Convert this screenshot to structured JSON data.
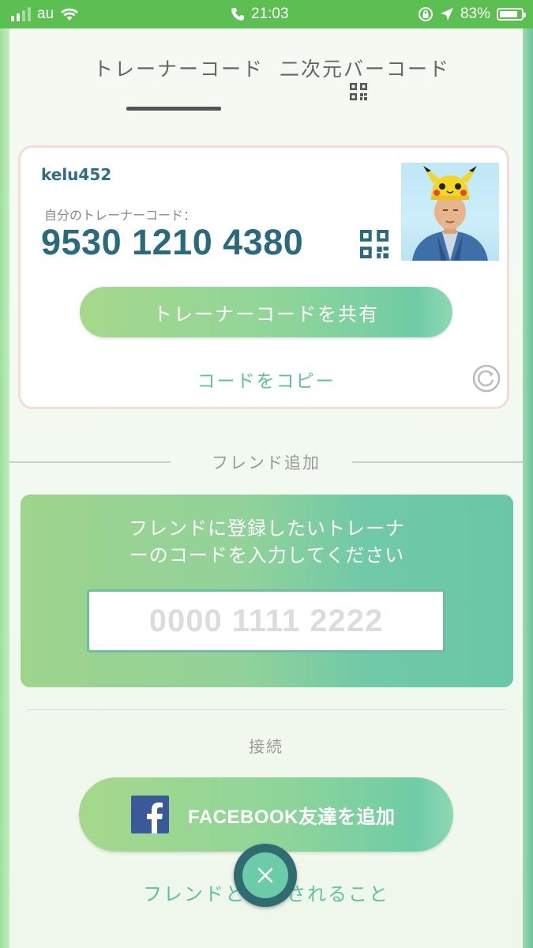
{
  "status_bar": {
    "carrier": "au",
    "time": "21:03",
    "battery": "83%",
    "battery_level": 0.83,
    "icons": [
      "signal-icon",
      "wifi-icon",
      "phone-icon",
      "orientation-lock-icon",
      "location-arrow-icon",
      "battery-icon"
    ]
  },
  "tabs": {
    "trainer_code": "トレーナーコード",
    "qr_code": "二次元バーコード",
    "active": "trainer_code"
  },
  "card": {
    "username": "kelu452",
    "code_label": "自分のトレーナーコード：",
    "code_value": "9530 1210 4380",
    "share_button": "トレーナーコードを共有",
    "copy_link": "コードをコピー"
  },
  "friend_add": {
    "heading": "フレンド追加",
    "prompt_line1": "フレンドに登録したいトレーナ",
    "prompt_line2": "ーのコードを入力してください",
    "input_placeholder": "0000 1111 2222",
    "input_value": ""
  },
  "connect": {
    "heading": "接続",
    "facebook_button": "FACEBOOK友達を追加"
  },
  "bottom": {
    "link_text": "フレンドと　　されること"
  },
  "colors": {
    "status_bar": "#5cbf52",
    "accent_teal": "#2b6a7d",
    "link_green": "#5fc1a1",
    "facebook_blue": "#3b5998"
  }
}
